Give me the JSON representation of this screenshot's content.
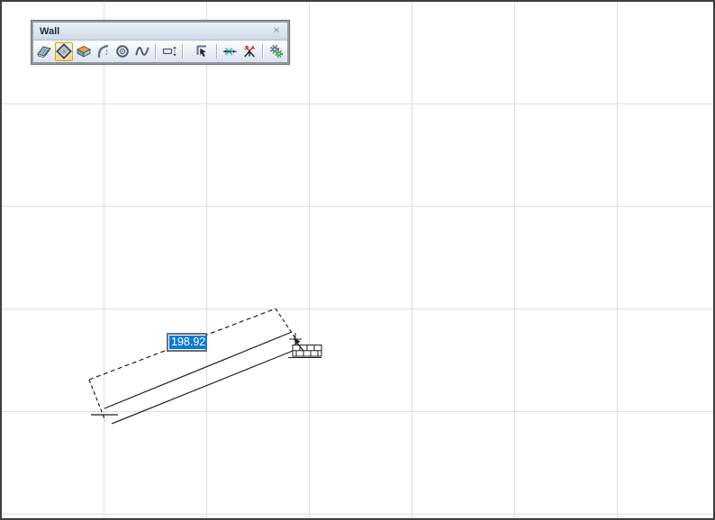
{
  "window": {
    "title": "Wall",
    "close_glyph": "✕"
  },
  "toolbar": {
    "buttons": [
      {
        "icon": "straight-wall-icon",
        "selected": false
      },
      {
        "icon": "polygon-wall-icon",
        "selected": true
      },
      {
        "icon": "corner-wall-icon",
        "selected": false
      },
      {
        "icon": "curved-wall-icon",
        "selected": false
      },
      {
        "icon": "circular-wall-icon",
        "selected": false
      },
      {
        "icon": "spline-wall-icon",
        "selected": false
      },
      {
        "icon": "wall-width-icon",
        "selected": false
      },
      {
        "icon": "pick-wall-icon",
        "selected": false
      },
      {
        "icon": "wall-join-icon",
        "selected": false
      },
      {
        "icon": "wall-break-icon",
        "selected": false
      },
      {
        "icon": "wall-settings-icon",
        "selected": false
      }
    ]
  },
  "tracker": {
    "value": "198.92"
  },
  "colors": {
    "selection_blue": "#0d7bd8",
    "selected_button_orange": "#d89e3f",
    "grid_line": "#dcdde9",
    "wall_line": "#1f1f1f",
    "titlebar_text": "#1c2a3c"
  }
}
